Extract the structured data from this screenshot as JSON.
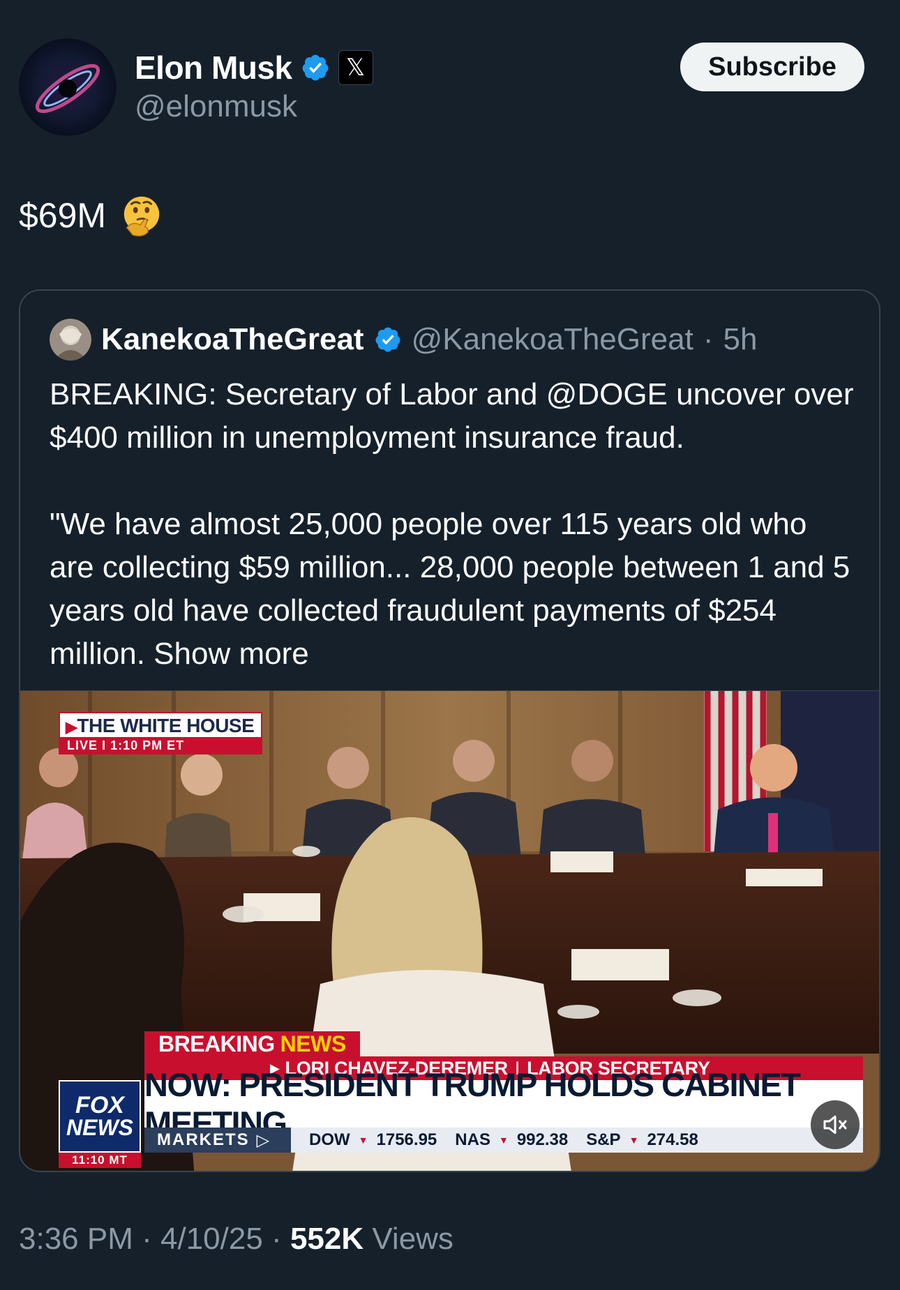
{
  "author": {
    "display_name": "Elon Musk",
    "handle": "@elonmusk",
    "verified_icon": "verified-badge-icon",
    "affiliation_icon": "x-logo-icon",
    "affiliation_glyph": "𝕏"
  },
  "subscribe": {
    "label": "Subscribe"
  },
  "tweet": {
    "text": "$69M",
    "emoji_icon": "thinking-face-emoji"
  },
  "quote": {
    "author_name": "KanekoaTheGreat",
    "author_handle": "@KanekoaTheGreat",
    "separator": "·",
    "time": "5h",
    "paragraph1": "BREAKING: Secretary of Labor and @DOGE uncover over $400 million in unemployment insurance fraud.",
    "paragraph2": "\"We have almost 25,000 people over 115 years old who are collecting $59 million... 28,000 people between 1 and 5 years old have collected fraudulent payments of $254 million.",
    "show_more": "Show more"
  },
  "media": {
    "wh_title": "THE WHITE HOUSE",
    "wh_live": "LIVE",
    "wh_sep": "I",
    "wh_time": "1:10 PM ET",
    "breaking": "BREAKING",
    "news": "NEWS",
    "strip_name": "LORI CHAVEZ-DEREMER",
    "strip_sep": "I",
    "strip_title": "LABOR SECRETARY",
    "headline": "NOW: PRESIDENT TRUMP HOLDS CABINET MEETING",
    "logo_line1": "FOX",
    "logo_line2": "NEWS",
    "logo_time": "11:10 MT",
    "ticker_label": "MARKETS",
    "ticker": [
      {
        "name": "DOW",
        "value": "1756.95"
      },
      {
        "name": "NAS",
        "value": "992.38"
      },
      {
        "name": "S&P",
        "value": "274.58"
      }
    ],
    "mute_icon": "speaker-muted-icon"
  },
  "footer": {
    "time": "3:36 PM",
    "sep1": "·",
    "date": "4/10/25",
    "sep2": "·",
    "views_count": "552K",
    "views_label": "Views"
  },
  "colors": {
    "background": "#15202b",
    "secondary_text": "#8b98a5",
    "verified_blue": "#1d9bf0",
    "fox_red": "#c8102e",
    "fox_navy": "#0e2a6a"
  }
}
